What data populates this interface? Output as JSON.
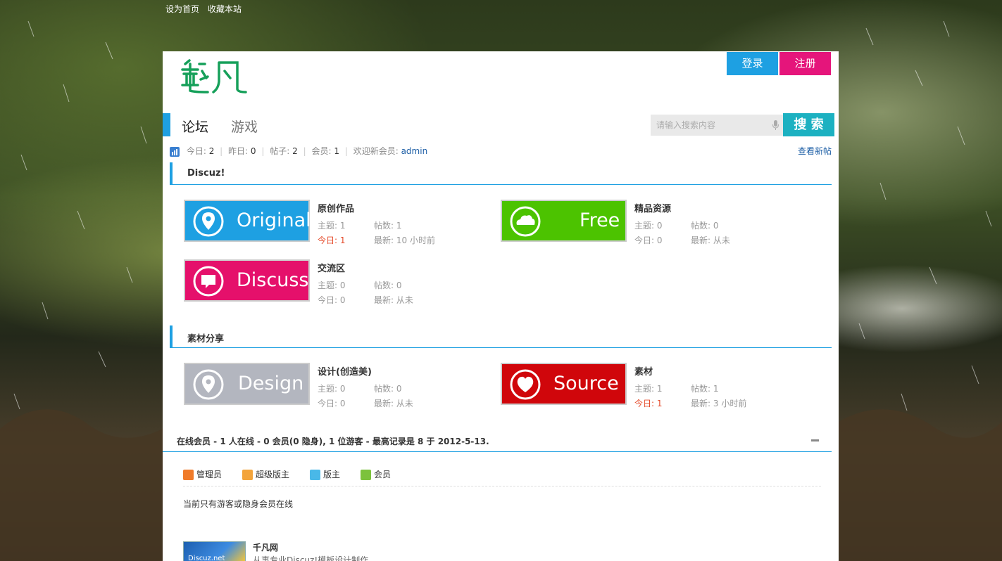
{
  "topbar": {
    "set_home": "设为首页",
    "bookmark": "收藏本站"
  },
  "header": {
    "logo_text": "魅凡",
    "login": "登录",
    "register": "注册"
  },
  "nav": {
    "tabs": [
      "论坛",
      "游戏"
    ],
    "search_placeholder": "请输入搜索内容",
    "search_button": "搜 索"
  },
  "stats": {
    "today_label": "今日:",
    "today": "2",
    "yesterday_label": "昨日:",
    "yesterday": "0",
    "posts_label": "帖子:",
    "posts": "2",
    "members_label": "会员:",
    "members": "1",
    "welcome_label": "欢迎新会员:",
    "new_member": "admin",
    "view_new": "查看新帖"
  },
  "sections": [
    {
      "title": "Discuz!",
      "forums": [
        {
          "banner": "Original",
          "color": "#1ea0e2",
          "icon": "location-pin-icon",
          "name": "原创作品",
          "topics_label": "主题:",
          "topics": "1",
          "posts_label": "帖数:",
          "posts": "1",
          "today_label": "今日:",
          "today": "1",
          "latest_label": "最新:",
          "latest": "10 小时前"
        },
        {
          "banner": "Free",
          "color": "#4cc300",
          "icon": "cloud-icon",
          "name": "精品资源",
          "topics_label": "主题:",
          "topics": "0",
          "posts_label": "帖数:",
          "posts": "0",
          "today_label": "今日:",
          "today": "0",
          "latest_label": "最新:",
          "latest": "从未"
        },
        {
          "banner": "Discuss",
          "color": "#e5106b",
          "icon": "chat-bubble-icon",
          "name": "交流区",
          "topics_label": "主题:",
          "topics": "0",
          "posts_label": "帖数:",
          "posts": "0",
          "today_label": "今日:",
          "today": "0",
          "latest_label": "最新:",
          "latest": "从未"
        }
      ]
    },
    {
      "title": "素材分享",
      "forums": [
        {
          "banner": "Design",
          "color": "#b3b6bf",
          "icon": "location-pin-icon",
          "name": "设计(创造美)",
          "topics_label": "主题:",
          "topics": "0",
          "posts_label": "帖数:",
          "posts": "0",
          "today_label": "今日:",
          "today": "0",
          "latest_label": "最新:",
          "latest": "从未"
        },
        {
          "banner": "Source",
          "color": "#d0060b",
          "icon": "heart-icon",
          "name": "素材",
          "topics_label": "主题:",
          "topics": "1",
          "posts_label": "帖数:",
          "posts": "1",
          "today_label": "今日:",
          "today": "1",
          "latest_label": "最新:",
          "latest": "3 小时前"
        }
      ]
    }
  ],
  "online": {
    "summary": "在线会员 - 1 人在线 - 0 会员(0 隐身), 1 位游客 - 最高记录是 8 于 2012-5-13.",
    "legend": [
      {
        "label": "管理员",
        "color": "#f07b2a"
      },
      {
        "label": "超级版主",
        "color": "#f3a43b"
      },
      {
        "label": "版主",
        "color": "#49b8e8"
      },
      {
        "label": "会员",
        "color": "#7cc23c"
      }
    ],
    "status": "当前只有游客或隐身会员在线"
  },
  "friend_link": {
    "name": "千凡网",
    "desc": "从事专业Discuz!模板设计制作",
    "image_text": "Discuz.net"
  }
}
